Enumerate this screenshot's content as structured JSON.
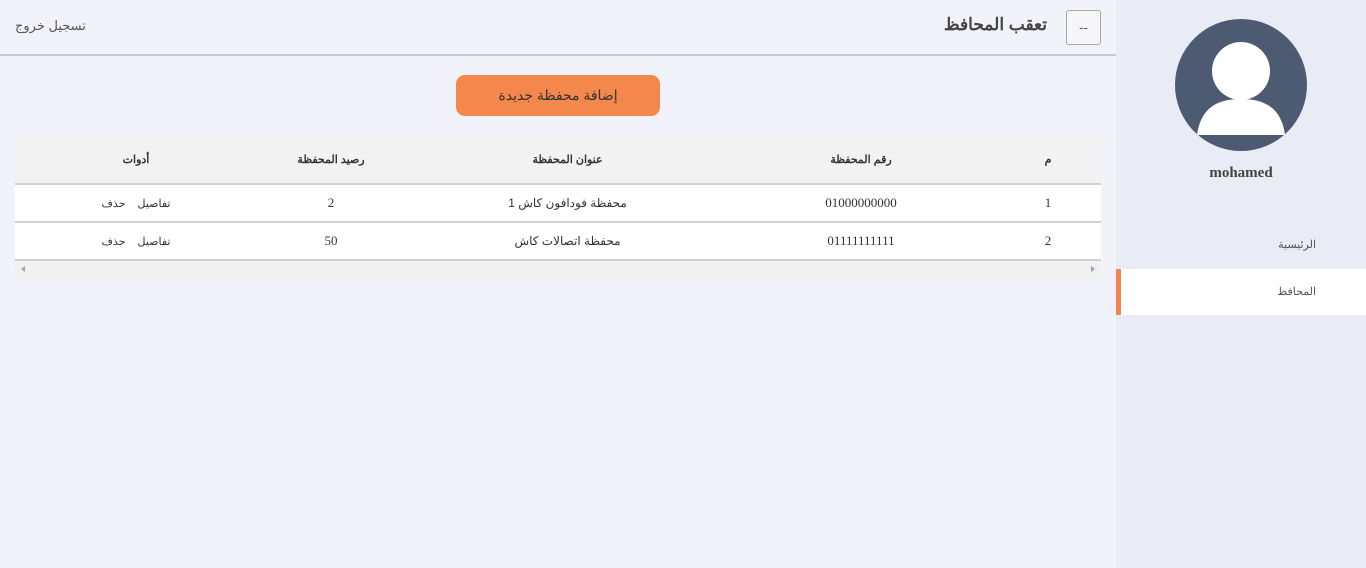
{
  "header": {
    "title": "تعقب المحافظ",
    "menu_button": "--",
    "logout": "تسجيل خروج"
  },
  "sidebar": {
    "username": "mohamed",
    "items": [
      {
        "label": "الرئيسية",
        "active": false
      },
      {
        "label": "المحافظ",
        "active": true
      }
    ]
  },
  "actions": {
    "add_wallet": "إضافة محفظة جديدة"
  },
  "table": {
    "columns": [
      "م",
      "رقم المحفظة",
      "عنوان المحفظة",
      "رصيد المحفظة",
      "أدوات"
    ],
    "rows": [
      {
        "index": "1",
        "wallet_number": "01000000000",
        "wallet_title": "محفظة فودافون كاش 1",
        "balance": "2",
        "details": "تفاصيل",
        "delete": "حذف"
      },
      {
        "index": "2",
        "wallet_number": "01111111111",
        "wallet_title": "محفظة اتصالات كاش",
        "balance": "50",
        "details": "تفاصيل",
        "delete": "حذف"
      }
    ]
  },
  "colors": {
    "accent": "#f4874c",
    "avatar_bg": "#4c5a72",
    "page_bg": "#f2f3fa",
    "sidebar_bg": "#e9ebf5"
  },
  "icons": {
    "avatar": "user-silhouette-icon",
    "scroll_left": "arrow-left-icon",
    "scroll_right": "arrow-right-icon"
  }
}
